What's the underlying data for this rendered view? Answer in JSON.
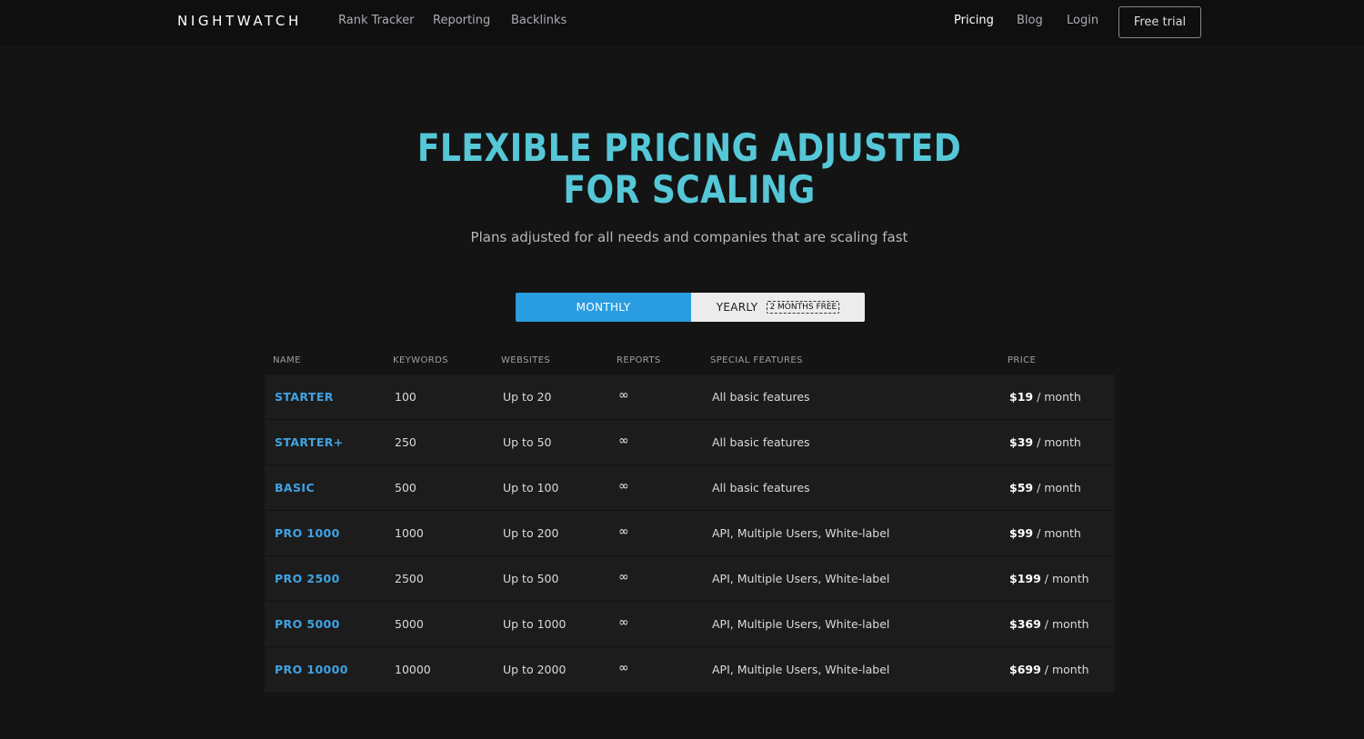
{
  "header": {
    "logo": "NIGHTWATCH",
    "nav_left": [
      "Rank Tracker",
      "Reporting",
      "Backlinks"
    ],
    "nav_right": [
      "Pricing",
      "Blog",
      "Login"
    ],
    "active": "Pricing",
    "cta": "Free trial"
  },
  "hero": {
    "title_line1": "FLEXIBLE PRICING ADJUSTED",
    "title_line2": "FOR SCALING",
    "subtitle": "Plans adjusted for all needs and companies that are scaling fast"
  },
  "billing_toggle": {
    "monthly": "MONTHLY",
    "yearly": "YEARLY",
    "yearly_badge": "2 MONTHS FREE",
    "selected": "MONTHLY"
  },
  "table": {
    "columns": [
      "NAME",
      "KEYWORDS",
      "WEBSITES",
      "REPORTS",
      "SPECIAL FEATURES",
      "PRICE"
    ],
    "rows": [
      {
        "name": "STARTER",
        "keywords": "100",
        "websites": "Up to 20",
        "reports": "∞",
        "features": "All basic features",
        "price": "$19",
        "period": " / month"
      },
      {
        "name": "STARTER+",
        "keywords": "250",
        "websites": "Up to 50",
        "reports": "∞",
        "features": "All basic features",
        "price": "$39",
        "period": " / month"
      },
      {
        "name": "BASIC",
        "keywords": "500",
        "websites": "Up to 100",
        "reports": "∞",
        "features": "All basic features",
        "price": "$59",
        "period": " / month"
      },
      {
        "name": "PRO 1000",
        "keywords": "1000",
        "websites": "Up to 200",
        "reports": "∞",
        "features": "API, Multiple Users, White-label",
        "price": "$99",
        "period": " / month"
      },
      {
        "name": "PRO 2500",
        "keywords": "2500",
        "websites": "Up to 500",
        "reports": "∞",
        "features": "API, Multiple Users, White-label",
        "price": "$199",
        "period": " / month"
      },
      {
        "name": "PRO 5000",
        "keywords": "5000",
        "websites": "Up to 1000",
        "reports": "∞",
        "features": "API, Multiple Users, White-label",
        "price": "$369",
        "period": " / month"
      },
      {
        "name": "PRO 10000",
        "keywords": "10000",
        "websites": "Up to 2000",
        "reports": "∞",
        "features": "API, Multiple Users, White-label",
        "price": "$699",
        "period": " / month"
      }
    ]
  },
  "colors": {
    "accent_title": "#55c7d6",
    "accent_blue": "#2a9de0",
    "plan_name": "#3fa3e3",
    "background": "#141414"
  }
}
